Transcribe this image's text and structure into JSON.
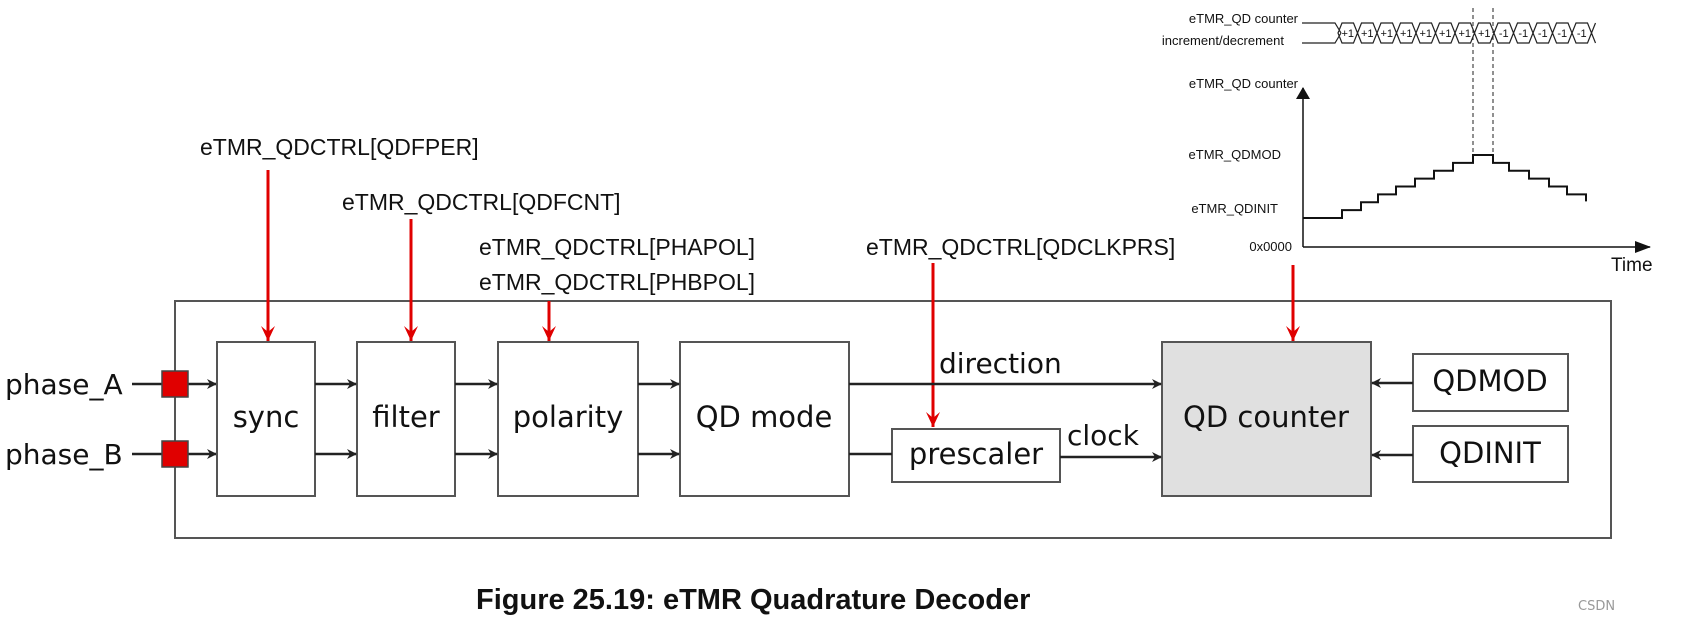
{
  "registers": {
    "qdfper": "eTMR_QDCTRL[QDFPER]",
    "qdfcnt": "eTMR_QDCTRL[QDFCNT]",
    "phapol": "eTMR_QDCTRL[PHAPOL]",
    "phbpol": "eTMR_QDCTRL[PHBPOL]",
    "qdclkprs": "eTMR_QDCTRL[QDCLKPRS]"
  },
  "inputs": {
    "a": "phase_A",
    "b": "phase_B"
  },
  "blocks": {
    "sync": "sync",
    "filter": "filter",
    "polarity": "polarity",
    "qd_mode": "QD mode",
    "prescaler": "prescaler",
    "qd_counter": "QD counter",
    "qdmod": "QDMOD",
    "qdinit": "QDINIT"
  },
  "signals": {
    "direction": "direction",
    "clock": "clock"
  },
  "timing": {
    "bus_label_1": "eTMR_QD counter",
    "bus_label_2": "increment/decrement",
    "counter_label": "eTMR_QD counter",
    "qdmod_label": "eTMR_QDMOD",
    "qdinit_label": "eTMR_QDINIT",
    "zero_label": "0x0000",
    "time_label": "Time",
    "increments": [
      "+1",
      "+1",
      "+1",
      "+1",
      "+1",
      "+1",
      "+1",
      "+1",
      "-1",
      "-1",
      "-1",
      "-1",
      "-1"
    ]
  },
  "colors": {
    "arrow": "#e00000",
    "pin": "#e00000",
    "counter_fill": "#e0e0e0"
  },
  "caption": "Figure 25.19:  eTMR Quadrature Decoder",
  "watermark": "CSDN"
}
